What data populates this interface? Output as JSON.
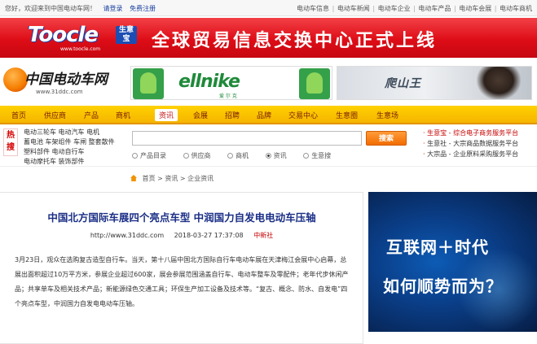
{
  "topbar": {
    "welcome": "您好，欢迎来到中国电动车网！",
    "login": "请登录",
    "register": "免费注册",
    "links": [
      "电动车信息",
      "电动车新闻",
      "电动车企业",
      "电动车产品",
      "电动车会展",
      "电动车商机"
    ]
  },
  "banner": {
    "logo_text": "Toocle",
    "logo_tag": "生意宝",
    "logo_url": "www.toocle.com",
    "slogan": "全球贸易信息交换中心正式上线"
  },
  "site": {
    "name": "中国电动车网",
    "url": "www.31ddc.com"
  },
  "ads": {
    "ad1_brand": "ellnike",
    "ad1_sub": "爱 尔 克",
    "ad2_text": "爬山王"
  },
  "nav": {
    "items": [
      "首页",
      "供应商",
      "产品",
      "商机",
      "资讯",
      "会展",
      "招聘",
      "品牌",
      "交易中心",
      "生意圈",
      "生意场"
    ],
    "active_index": 4
  },
  "search": {
    "hot_label": "热搜",
    "categories": [
      "电动三轮车 电动汽车 电机",
      "蓄电池 车架组件 车闸 整套散件",
      "塑料部件 电动自行车",
      "电动摩托车 装饰部件"
    ],
    "placeholder": "",
    "button": "搜索",
    "options": [
      "产品目录",
      "供应商",
      "商机",
      "资讯",
      "生意搜"
    ],
    "selected_option": "资讯",
    "services": [
      "生意宝 - 综合电子商务服务平台",
      "生意社 - 大宗商品数据服务平台",
      "大宗品 - 企业原料采购服务平台"
    ]
  },
  "breadcrumb": [
    "首页",
    "资讯",
    "企业资讯"
  ],
  "article": {
    "title": "中国北方国际车展四个亮点车型 中润国力自发电电动车压轴",
    "url": "http://www.31ddc.com",
    "date": "2018-03-27 17:37:08",
    "source": "中新社",
    "body": "3月23日，观众在选购复古造型自行车。当天，第十八届中国北方国际自行车电动车展在天津梅江会展中心启幕，总展出面积超过10万平方米，参展企业超过600家，展会参展范围涵盖自行车、电动车整车及零配件；老年代步休闲产品；共享单车及相关技术产品；新能源绿色交通工具；环保生产加工设备及技术等。“复古、概念、防水、自发电”四个亮点车型，中润国力自发电电动车压轴。"
  },
  "side_ad": {
    "line1": "互联网＋时代",
    "line2": "如何顺势而为？"
  }
}
